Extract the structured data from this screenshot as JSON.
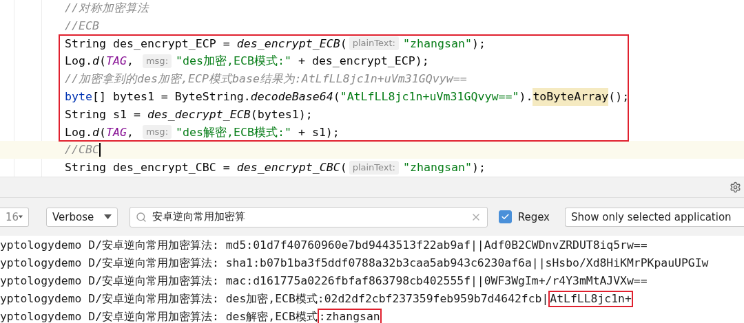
{
  "editor": {
    "lines": [
      {
        "boxed": false,
        "current": false,
        "segments": [
          {
            "kind": "comment",
            "text": "//对称加密算法"
          }
        ]
      },
      {
        "boxed": false,
        "current": false,
        "segments": [
          {
            "kind": "comment",
            "text": "//ECB"
          }
        ]
      },
      {
        "boxed": true,
        "current": false,
        "segments": [
          {
            "kind": "plain",
            "text": "String des_encrypt_ECP = "
          },
          {
            "kind": "method",
            "text": "des_encrypt_ECB"
          },
          {
            "kind": "plain",
            "text": "("
          },
          {
            "kind": "hint",
            "text": "plainText:"
          },
          {
            "kind": "string",
            "text": "\"zhangsan\""
          },
          {
            "kind": "plain",
            "text": ");"
          }
        ]
      },
      {
        "boxed": true,
        "current": false,
        "segments": [
          {
            "kind": "plain",
            "text": "Log."
          },
          {
            "kind": "method",
            "text": "d"
          },
          {
            "kind": "plain",
            "text": "("
          },
          {
            "kind": "constant",
            "text": "TAG"
          },
          {
            "kind": "plain",
            "text": ", "
          },
          {
            "kind": "hint",
            "text": "msg:"
          },
          {
            "kind": "string",
            "text": "\"des加密,ECB模式:\""
          },
          {
            "kind": "plain",
            "text": " + des_encrypt_ECP);"
          }
        ]
      },
      {
        "boxed": true,
        "current": false,
        "segments": [
          {
            "kind": "comment",
            "text": "//加密拿到的des加密,ECP模式base结果为:AtLfLL8jc1n+uVm31GQvyw=="
          }
        ]
      },
      {
        "boxed": true,
        "current": false,
        "segments": [
          {
            "kind": "keyword",
            "text": "byte"
          },
          {
            "kind": "plain",
            "text": "[] bytes1 = ByteString."
          },
          {
            "kind": "method",
            "text": "decodeBase64"
          },
          {
            "kind": "plain",
            "text": "("
          },
          {
            "kind": "string",
            "text": "\"AtLfLL8jc1n+uVm31GQvyw==\""
          },
          {
            "kind": "plain",
            "text": ")."
          },
          {
            "kind": "highlight",
            "text": "toByteArray"
          },
          {
            "kind": "plain",
            "text": "();"
          }
        ]
      },
      {
        "boxed": true,
        "current": false,
        "segments": [
          {
            "kind": "plain",
            "text": "String s1 = "
          },
          {
            "kind": "method",
            "text": "des_decrypt_ECB"
          },
          {
            "kind": "plain",
            "text": "(bytes1);"
          }
        ]
      },
      {
        "boxed": true,
        "current": false,
        "segments": [
          {
            "kind": "plain",
            "text": "Log."
          },
          {
            "kind": "method",
            "text": "d"
          },
          {
            "kind": "plain",
            "text": "("
          },
          {
            "kind": "constant",
            "text": "TAG"
          },
          {
            "kind": "plain",
            "text": ", "
          },
          {
            "kind": "hint",
            "text": "msg:"
          },
          {
            "kind": "string",
            "text": "\"des解密,ECB模式:\""
          },
          {
            "kind": "plain",
            "text": " + s1);"
          }
        ]
      },
      {
        "boxed": false,
        "current": true,
        "segments": [
          {
            "kind": "comment",
            "text": "//CBC"
          }
        ]
      },
      {
        "boxed": false,
        "current": false,
        "segments": [
          {
            "kind": "plain",
            "text": "String des_encrypt_CBC = "
          },
          {
            "kind": "method",
            "text": "des_encrypt_CBC"
          },
          {
            "kind": "plain",
            "text": "("
          },
          {
            "kind": "hint",
            "text": "plainText:"
          },
          {
            "kind": "string",
            "text": "\"zhangsan\""
          },
          {
            "kind": "plain",
            "text": ");"
          }
        ]
      }
    ]
  },
  "logcat": {
    "toolbar": {
      "device": "16",
      "level": "Verbose",
      "search": "安卓逆向常用加密算",
      "regex": {
        "label": "Regex",
        "checked": true
      },
      "filter": "Show only selected application"
    },
    "lines": [
      {
        "segments": [
          {
            "kind": "plain",
            "text": "yptologydemo D/安卓逆向常用加密算法: md5:01d7f40760960e7bd9443513f22ab9af||Adf0B2CWDnvZRDUT8iq5rw=="
          }
        ]
      },
      {
        "segments": [
          {
            "kind": "plain",
            "text": "yptologydemo D/安卓逆向常用加密算法: sha1:b07b1ba3f5ddf0788a32b3caa5ab943c6230af6a||sHsbo/Xd8HiKMrPKpauUPGIw"
          }
        ]
      },
      {
        "segments": [
          {
            "kind": "plain",
            "text": "yptologydemo D/安卓逆向常用加密算法: mac:d161775a0226fbfaf863798cb402555f||0WF3WgIm+/r4Y3mMtAJVXw=="
          }
        ]
      },
      {
        "segments": [
          {
            "kind": "plain",
            "text": "yptologydemo D/安卓逆向常用加密算法: des加密,ECB模式:02d2df2cbf237359feb959b7d4642fcb|"
          },
          {
            "kind": "boxed",
            "text": "AtLfLL8jc1n+"
          }
        ]
      },
      {
        "segments": [
          {
            "kind": "plain",
            "text": "yptologydemo D/安卓逆向常用加密算法: des解密,ECB模式"
          },
          {
            "kind": "boxed",
            "text": ":zhangsan"
          }
        ]
      }
    ]
  }
}
